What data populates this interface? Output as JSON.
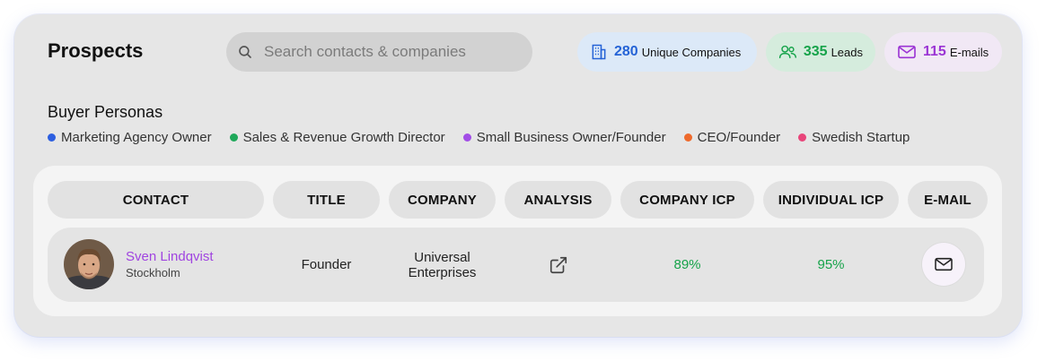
{
  "header": {
    "title": "Prospects",
    "search_placeholder": "Search contacts & companies"
  },
  "stats": {
    "companies": {
      "value": "280",
      "label": "Unique Companies",
      "icon": "building-icon",
      "color": "#2563d6"
    },
    "leads": {
      "value": "335",
      "label": "Leads",
      "icon": "users-icon",
      "color": "#16a34a"
    },
    "emails": {
      "value": "115",
      "label": "E-mails",
      "icon": "envelope-icon",
      "color": "#9b34d4"
    }
  },
  "personas": {
    "title": "Buyer Personas",
    "items": [
      {
        "label": "Marketing Agency Owner",
        "color": "#2d5fe0"
      },
      {
        "label": "Sales & Revenue Growth Director",
        "color": "#1fa85a"
      },
      {
        "label": "Small Business Owner/Founder",
        "color": "#a24de6"
      },
      {
        "label": "CEO/Founder",
        "color": "#ee6a2c"
      },
      {
        "label": "Swedish Startup",
        "color": "#e8457a"
      }
    ]
  },
  "table": {
    "columns": [
      "CONTACT",
      "TITLE",
      "COMPANY",
      "ANALYSIS",
      "COMPANY ICP",
      "INDIVIDUAL ICP",
      "E-MAIL"
    ],
    "rows": [
      {
        "name": "Sven Lindqvist",
        "city": "Stockholm",
        "title": "Founder",
        "company_line1": "Universal",
        "company_line2": "Enterprises",
        "analysis_icon": "external-link-icon",
        "company_icp": "89%",
        "individual_icp": "95%",
        "email_icon": "envelope-icon"
      }
    ]
  }
}
